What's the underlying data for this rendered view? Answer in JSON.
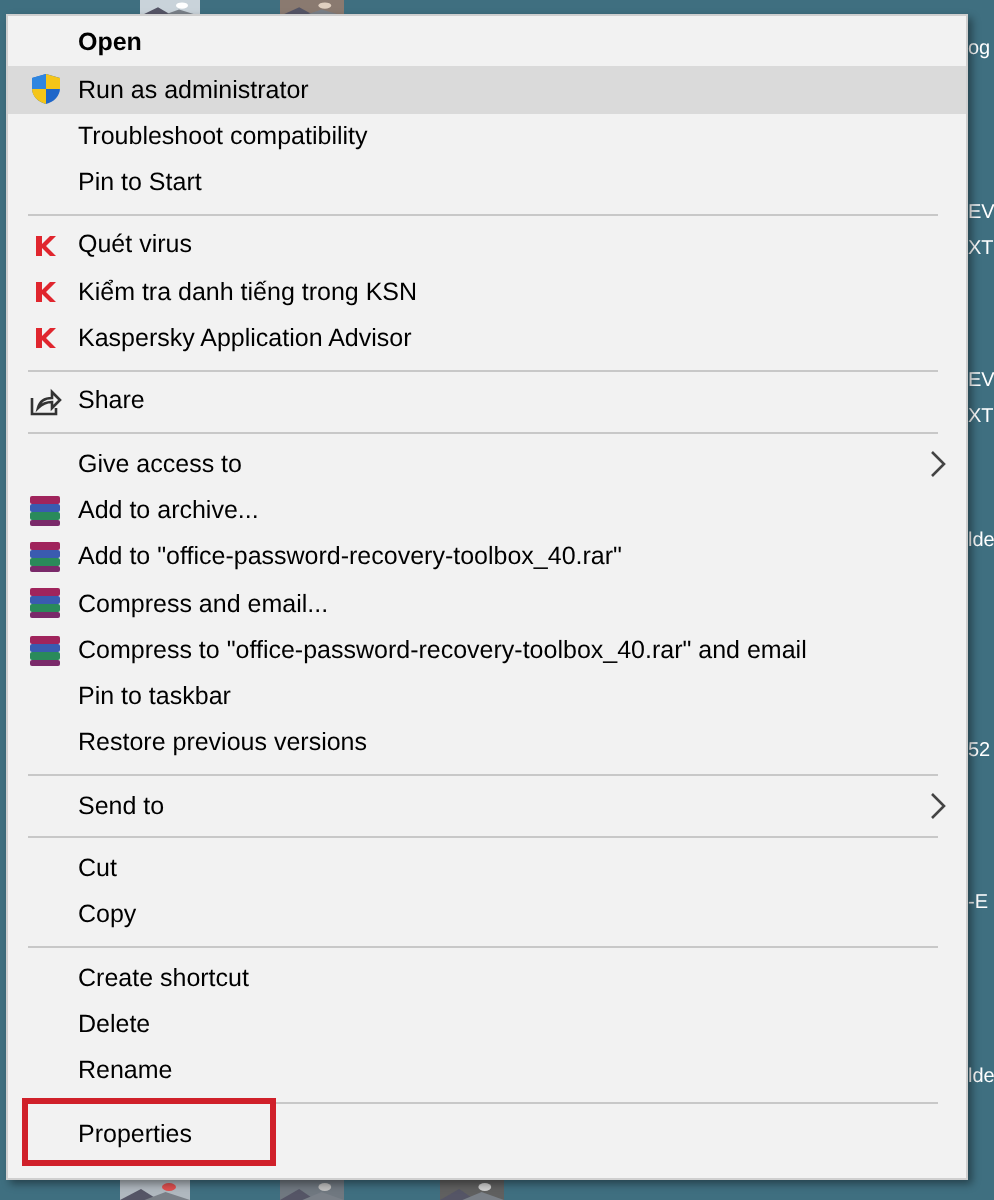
{
  "desktop": {
    "label_fragments": [
      "og",
      "EV",
      "XT",
      "EV",
      "XT",
      "lde",
      "52",
      "-E",
      "lde"
    ]
  },
  "menu": {
    "sections": [
      [
        {
          "label": "Open",
          "default": true,
          "selected": false
        },
        {
          "label": "Run as administrator",
          "kind": "shield",
          "selected": true
        },
        {
          "label": "Troubleshoot compatibility",
          "selected": false
        },
        {
          "label": "Pin to Start",
          "selected": false
        }
      ],
      [
        {
          "label": "Quét virus",
          "kind": "kaspersky",
          "selected": false
        },
        {
          "label": "Kiểm tra danh tiếng trong KSN",
          "kind": "kaspersky",
          "selected": false
        },
        {
          "label": "Kaspersky Application Advisor",
          "kind": "kaspersky",
          "selected": false
        }
      ],
      [
        {
          "label": "Share",
          "kind": "share",
          "selected": false
        }
      ],
      [
        {
          "label": "Give access to",
          "submenu": true,
          "selected": false
        },
        {
          "label": "Add to archive...",
          "kind": "winrar",
          "selected": false
        },
        {
          "label": "Add to \"office-password-recovery-toolbox_40.rar\"",
          "kind": "winrar",
          "selected": false
        },
        {
          "label": "Compress and email...",
          "kind": "winrar",
          "selected": false
        },
        {
          "label": "Compress to \"office-password-recovery-toolbox_40.rar\" and email",
          "kind": "winrar",
          "selected": false
        },
        {
          "label": "Pin to taskbar",
          "selected": false
        },
        {
          "label": "Restore previous versions",
          "selected": false
        }
      ],
      [
        {
          "label": "Send to",
          "submenu": true,
          "selected": false
        }
      ],
      [
        {
          "label": "Cut",
          "selected": false
        },
        {
          "label": "Copy",
          "selected": false
        }
      ],
      [
        {
          "label": "Create shortcut",
          "selected": false
        },
        {
          "label": "Delete",
          "selected": false
        },
        {
          "label": "Rename",
          "selected": false
        }
      ],
      [
        {
          "label": "Properties",
          "outlined": true,
          "selected": false
        }
      ]
    ]
  }
}
